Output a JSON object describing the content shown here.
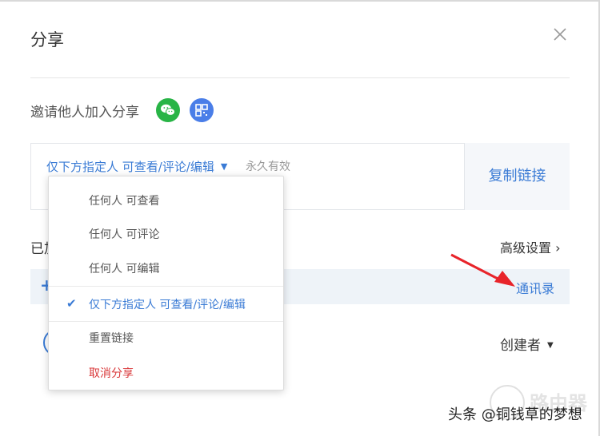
{
  "dialog": {
    "title": "分享",
    "close_icon": "close-icon"
  },
  "invite": {
    "label": "邀请他人加入分享",
    "wechat_icon": "wechat-icon",
    "qrcode_icon": "qrcode-icon"
  },
  "link": {
    "permission": "仅下方指定人 可查看/评论/编辑",
    "expiry": "永久有效",
    "copy_label": "复制链接"
  },
  "collaborators": {
    "section_label": "已加",
    "advanced_label": "高级设置 ›",
    "contacts_label": "通讯录",
    "add_icon": "plus-icon",
    "owner_role": "创建者"
  },
  "dropdown": {
    "items": [
      {
        "label": "任何人 可查看"
      },
      {
        "label": "任何人 可评论"
      },
      {
        "label": "任何人 可编辑"
      },
      {
        "label": "仅下方指定人 可查看/评论/编辑",
        "selected": true
      },
      {
        "label": "重置链接"
      },
      {
        "label": "取消分享",
        "danger": true
      }
    ]
  },
  "watermark": {
    "text": "头条 @铜钱草的梦想",
    "logo_text": "路由器"
  },
  "colors": {
    "accent": "#3a7bd5",
    "wechat": "#28b446",
    "danger": "#d9383a",
    "annotation_arrow": "#e8242a"
  }
}
